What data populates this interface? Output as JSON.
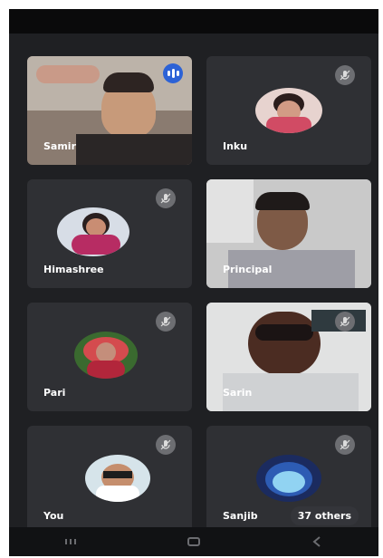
{
  "participants": [
    {
      "name": "Samir",
      "muted": false,
      "speaking": true
    },
    {
      "name": "Inku",
      "muted": true
    },
    {
      "name": "Himashree",
      "muted": true
    },
    {
      "name": "Principal",
      "muted": false
    },
    {
      "name": "Pari",
      "muted": true
    },
    {
      "name": "Sarin",
      "muted": true
    },
    {
      "name": "You",
      "muted": true
    },
    {
      "name": "Sanjib",
      "muted": true
    }
  ],
  "overflow": {
    "label": "37 others"
  },
  "icons": {
    "mute": "mic-off-icon",
    "speaking": "audio-level-icon",
    "nav_back": "back-icon",
    "nav_home": "home-icon",
    "nav_recents": "recents-icon"
  },
  "colors": {
    "background": "#1f2023",
    "tile": "#2f3034",
    "speaking": "#2c62d6"
  }
}
